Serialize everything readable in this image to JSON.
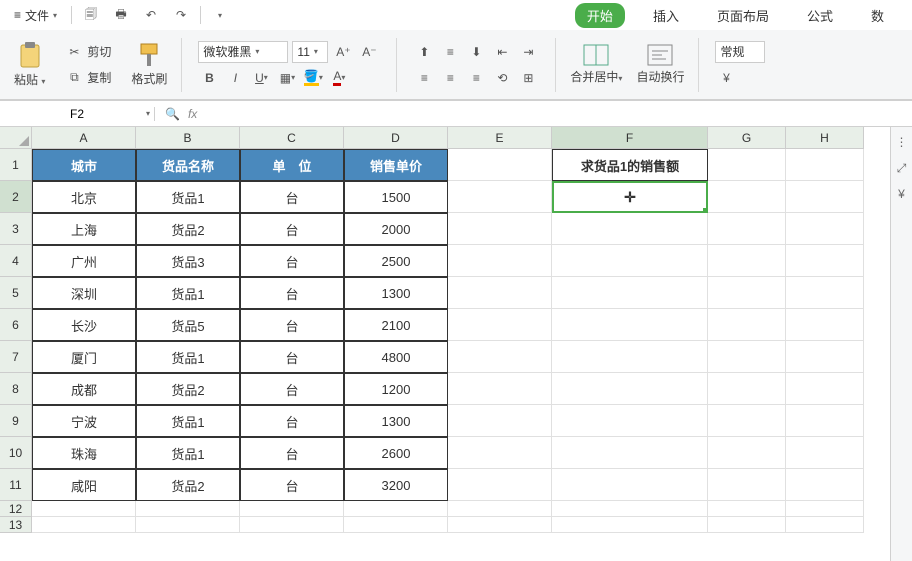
{
  "menu": {
    "file": "文件",
    "quick": {
      "save": "💾",
      "print": "🖨",
      "undo": "↶",
      "redo": "↷"
    }
  },
  "tabs": {
    "start": "开始",
    "insert": "插入",
    "layout": "页面布局",
    "formula": "公式",
    "data": "数"
  },
  "ribbon": {
    "paste": "粘贴",
    "cut": "剪切",
    "copy": "复制",
    "format_painter": "格式刷",
    "font_name": "微软雅黑",
    "font_size": "11",
    "merge_center": "合并居中",
    "wrap_text": "自动换行",
    "general": "常规"
  },
  "name_box": "F2",
  "columns": [
    "A",
    "B",
    "C",
    "D",
    "E",
    "F",
    "G",
    "H"
  ],
  "rows": [
    "1",
    "2",
    "3",
    "4",
    "5",
    "6",
    "7",
    "8",
    "9",
    "10",
    "11",
    "12",
    "13"
  ],
  "table": {
    "headers": [
      "城市",
      "货品名称",
      "单　位",
      "销售单价"
    ],
    "rows": [
      [
        "北京",
        "货品1",
        "台",
        "1500"
      ],
      [
        "上海",
        "货品2",
        "台",
        "2000"
      ],
      [
        "广州",
        "货品3",
        "台",
        "2500"
      ],
      [
        "深圳",
        "货品1",
        "台",
        "1300"
      ],
      [
        "长沙",
        "货品5",
        "台",
        "2100"
      ],
      [
        "厦门",
        "货品1",
        "台",
        "4800"
      ],
      [
        "成都",
        "货品2",
        "台",
        "1200"
      ],
      [
        "宁波",
        "货品1",
        "台",
        "1300"
      ],
      [
        "珠海",
        "货品1",
        "台",
        "2600"
      ],
      [
        "咸阳",
        "货品2",
        "台",
        "3200"
      ]
    ]
  },
  "f1_text": "求货品1的销售额",
  "cursor_glyph": "✛"
}
